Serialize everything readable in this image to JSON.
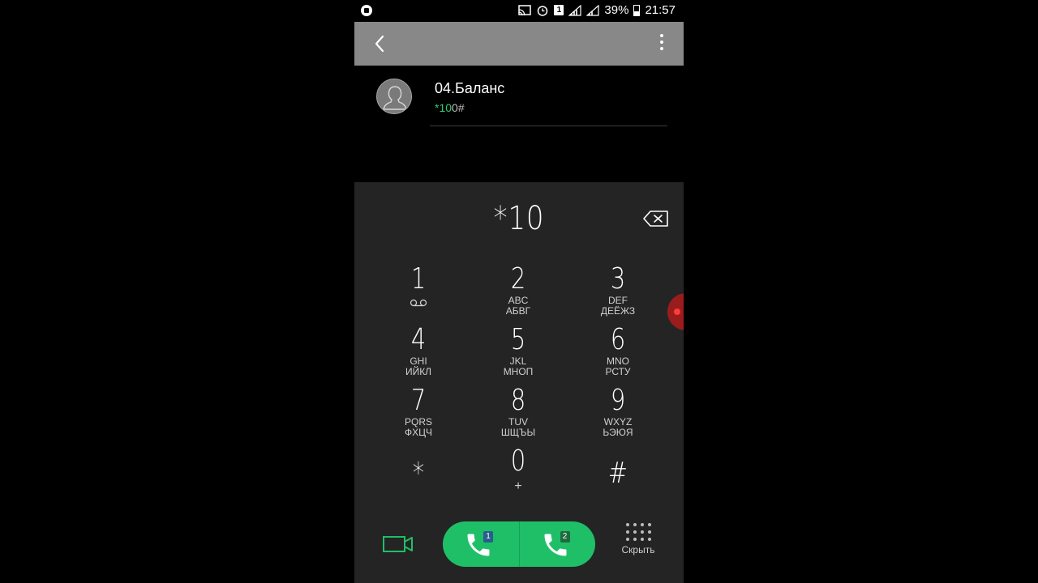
{
  "status_bar": {
    "battery_percent": "39%",
    "time": "21:57",
    "sim_indicator": "1",
    "icons": [
      "screen-cast-icon",
      "alarm-icon",
      "sim-1-icon",
      "signal-icon",
      "signal-icon",
      "battery-icon"
    ]
  },
  "action_bar": {
    "back_icon": "chevron-left-icon",
    "menu_icon": "more-vertical-icon"
  },
  "contact": {
    "name": "04.Баланс",
    "number_match": "*10",
    "number_rest": "0#"
  },
  "dialer": {
    "input": "*10",
    "keys": [
      {
        "num": "1",
        "sub1": "",
        "sub2": ""
      },
      {
        "num": "2",
        "sub1": "ABC",
        "sub2": "АБВГ"
      },
      {
        "num": "3",
        "sub1": "DEF",
        "sub2": "ДЕЁЖЗ"
      },
      {
        "num": "4",
        "sub1": "GHI",
        "sub2": "ИЙКЛ"
      },
      {
        "num": "5",
        "sub1": "JKL",
        "sub2": "МНОП"
      },
      {
        "num": "6",
        "sub1": "MNO",
        "sub2": "РСТУ"
      },
      {
        "num": "7",
        "sub1": "PQRS",
        "sub2": "ФХЦЧ"
      },
      {
        "num": "8",
        "sub1": "TUV",
        "sub2": "ШЩЪЫ"
      },
      {
        "num": "9",
        "sub1": "WXYZ",
        "sub2": "ЬЭЮЯ"
      },
      {
        "num": "*",
        "sub1": "",
        "sub2": ""
      },
      {
        "num": "0",
        "sub1": "+",
        "sub2": ""
      },
      {
        "num": "#",
        "sub1": "",
        "sub2": ""
      }
    ],
    "call_sim1_label": "1",
    "call_sim2_label": "2",
    "hide_label": "Скрыть"
  },
  "colors": {
    "accent_green": "#1fbf68",
    "action_bar": "#888888",
    "dialer_bg": "#242424"
  }
}
